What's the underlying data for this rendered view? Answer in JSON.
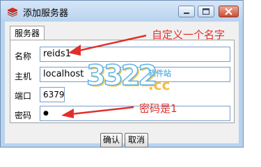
{
  "window": {
    "title": "添加服务器"
  },
  "tab": {
    "label": "服务器"
  },
  "form": {
    "name_label": "名称",
    "name_value": "reids1",
    "host_label": "主机",
    "host_value": "localhost",
    "port_label": "端口",
    "port_value": "6379",
    "password_label": "密码",
    "password_value": "●"
  },
  "buttons": {
    "ok": "确认",
    "cancel": "取消"
  },
  "annotations": {
    "name_hint": "自定义一个名字",
    "password_hint": "密码是1",
    "color": "#e0302b"
  },
  "watermark": {
    "number": "3322",
    "domain": ".cc",
    "text": "软件站"
  }
}
